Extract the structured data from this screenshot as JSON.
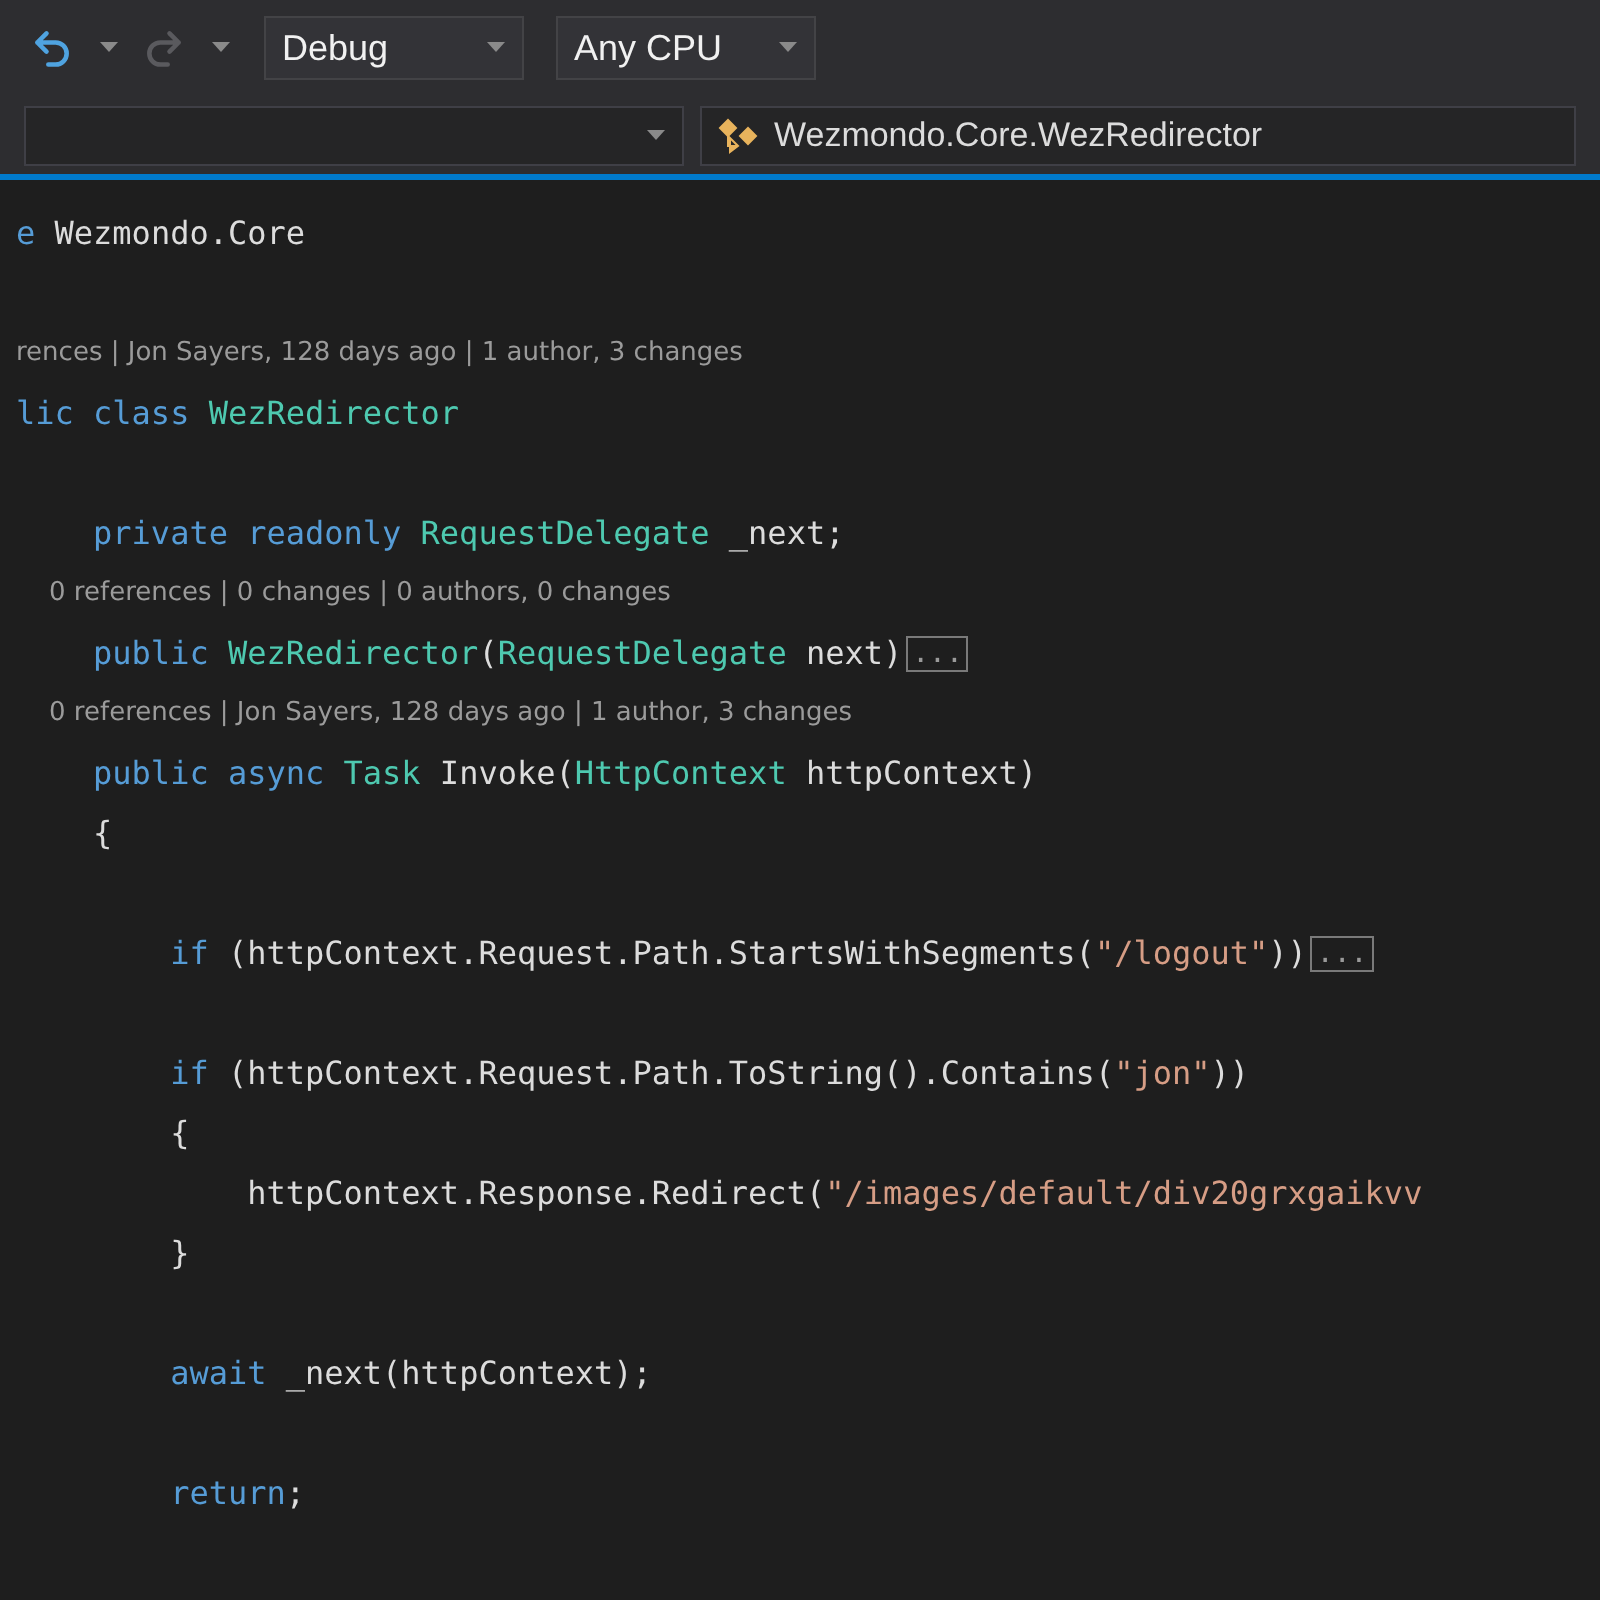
{
  "toolbar": {
    "items": [
      {
        "kind": "undo",
        "disabled": false
      },
      {
        "kind": "caret"
      },
      {
        "kind": "redo",
        "disabled": true
      },
      {
        "kind": "caret"
      },
      {
        "kind": "dropdown",
        "label": "Debug"
      },
      {
        "kind": "dropdown",
        "label": "Any CPU"
      }
    ]
  },
  "navigation_bar": {
    "right_dropdown": {
      "label": "Wezmondo.Core.WezRedirector"
    }
  },
  "editor": {
    "lines": [
      {
        "kind": "code",
        "tokens": [
          {
            "kind": "keyword",
            "text": "e"
          },
          {
            "kind": "plain",
            "text": " Wezmondo.Core"
          }
        ]
      },
      {
        "kind": "blank"
      },
      {
        "kind": "lens",
        "text": "rences | Jon Sayers, 128 days ago | 1 author, 3 changes"
      },
      {
        "kind": "code",
        "tokens": [
          {
            "kind": "keyword",
            "text": "lic class"
          },
          {
            "kind": "type",
            "text": " WezRedirector"
          }
        ]
      },
      {
        "kind": "blank"
      },
      {
        "kind": "code",
        "tokens": [
          {
            "kind": "keyword",
            "text": "    private readonly"
          },
          {
            "kind": "type",
            "text": " RequestDelegate"
          },
          {
            "kind": "plain",
            "text": " _next;"
          }
        ]
      },
      {
        "kind": "lens",
        "text": "    0 references | 0 changes | 0 authors, 0 changes"
      },
      {
        "kind": "code",
        "tokens": [
          {
            "kind": "keyword",
            "text": "    public"
          },
          {
            "kind": "type",
            "text": " WezRedirector"
          },
          {
            "kind": "plain",
            "text": "("
          },
          {
            "kind": "type",
            "text": "RequestDelegate"
          },
          {
            "kind": "plain",
            "text": " next)"
          },
          {
            "kind": "collapsed",
            "text": "..."
          }
        ]
      },
      {
        "kind": "lens",
        "text": "    0 references | Jon Sayers, 128 days ago | 1 author, 3 changes"
      },
      {
        "kind": "code",
        "tokens": [
          {
            "kind": "keyword",
            "text": "    public async"
          },
          {
            "kind": "type",
            "text": " Task"
          },
          {
            "kind": "plain",
            "text": " Invoke("
          },
          {
            "kind": "type",
            "text": "HttpContext"
          },
          {
            "kind": "plain",
            "text": " httpContext)"
          }
        ]
      },
      {
        "kind": "code",
        "tokens": [
          {
            "kind": "plain",
            "text": "    {"
          }
        ]
      },
      {
        "kind": "blank"
      },
      {
        "kind": "code",
        "tokens": [
          {
            "kind": "keyword",
            "text": "        if"
          },
          {
            "kind": "plain",
            "text": " (httpContext.Request.Path.StartsWithSegments("
          },
          {
            "kind": "string",
            "text": "\"/logout\""
          },
          {
            "kind": "plain",
            "text": "))"
          },
          {
            "kind": "collapsed",
            "text": "..."
          }
        ]
      },
      {
        "kind": "blank"
      },
      {
        "kind": "code",
        "tokens": [
          {
            "kind": "keyword",
            "text": "        if"
          },
          {
            "kind": "plain",
            "text": " (httpContext.Request.Path.ToString().Contains("
          },
          {
            "kind": "string",
            "text": "\"jon\""
          },
          {
            "kind": "plain",
            "text": "))"
          }
        ]
      },
      {
        "kind": "code",
        "tokens": [
          {
            "kind": "plain",
            "text": "        {"
          }
        ]
      },
      {
        "kind": "code",
        "tokens": [
          {
            "kind": "plain",
            "text": "            httpContext.Response.Redirect("
          },
          {
            "kind": "string",
            "text": "\"/images/default/div20grxgaikvv"
          }
        ]
      },
      {
        "kind": "code",
        "tokens": [
          {
            "kind": "plain",
            "text": "        }"
          }
        ]
      },
      {
        "kind": "blank"
      },
      {
        "kind": "code",
        "tokens": [
          {
            "kind": "keyword",
            "text": "        await"
          },
          {
            "kind": "plain",
            "text": " _next(httpContext);"
          }
        ]
      },
      {
        "kind": "blank"
      },
      {
        "kind": "code",
        "tokens": [
          {
            "kind": "keyword",
            "text": "        return"
          },
          {
            "kind": "plain",
            "text": ";"
          }
        ]
      }
    ]
  }
}
